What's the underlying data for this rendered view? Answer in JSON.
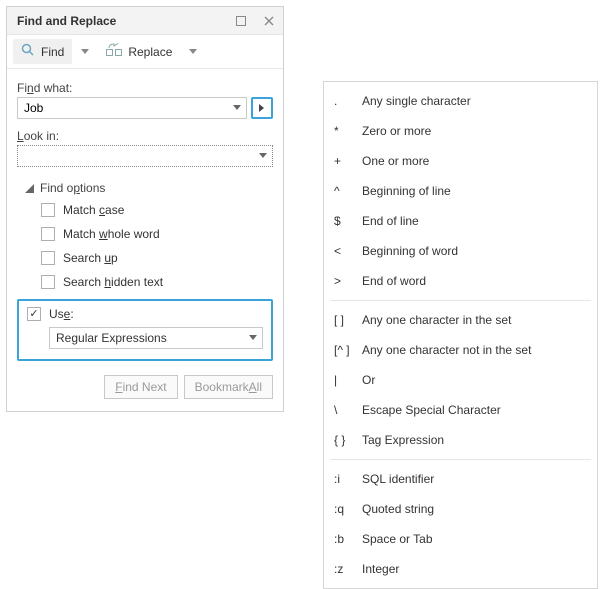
{
  "dialog": {
    "title": "Find and Replace",
    "tabs": {
      "find": "Find",
      "replace": "Replace"
    },
    "findWhatLabel": "Find what:",
    "findWhatValue": "Job",
    "lookInLabel": "Look in:",
    "lookInValue": "",
    "group": {
      "title": "Find options",
      "matchCase": "Match case",
      "matchWholeWord": "Match whole word",
      "searchUp": "Search up",
      "searchHiddenText": "Search hidden text"
    },
    "use": {
      "label": "Use:",
      "checked": true,
      "value": "Regular Expressions"
    },
    "actions": {
      "findNext": "Find Next",
      "bookmarkAll": "Bookmark All"
    }
  },
  "menu": {
    "items": [
      {
        "sym": ".",
        "label": "Any single character"
      },
      {
        "sym": "*",
        "label": "Zero or more"
      },
      {
        "sym": "+",
        "label": "One or more"
      },
      {
        "sym": "^",
        "label": "Beginning of line"
      },
      {
        "sym": "$",
        "label": "End of line"
      },
      {
        "sym": "<",
        "label": "Beginning of word"
      },
      {
        "sym": ">",
        "label": "End of word"
      },
      {
        "sep": true
      },
      {
        "sym": "[ ]",
        "label": "Any one character in the set"
      },
      {
        "sym": "[^ ]",
        "label": "Any one character not in the set"
      },
      {
        "sym": "|",
        "label": "Or"
      },
      {
        "sym": "\\",
        "label": "Escape Special Character"
      },
      {
        "sym": "{ }",
        "label": "Tag Expression"
      },
      {
        "sep": true
      },
      {
        "sym": ":i",
        "label": "SQL identifier"
      },
      {
        "sym": ":q",
        "label": "Quoted string"
      },
      {
        "sym": ":b",
        "label": "Space or Tab"
      },
      {
        "sym": ":z",
        "label": "Integer"
      }
    ]
  }
}
